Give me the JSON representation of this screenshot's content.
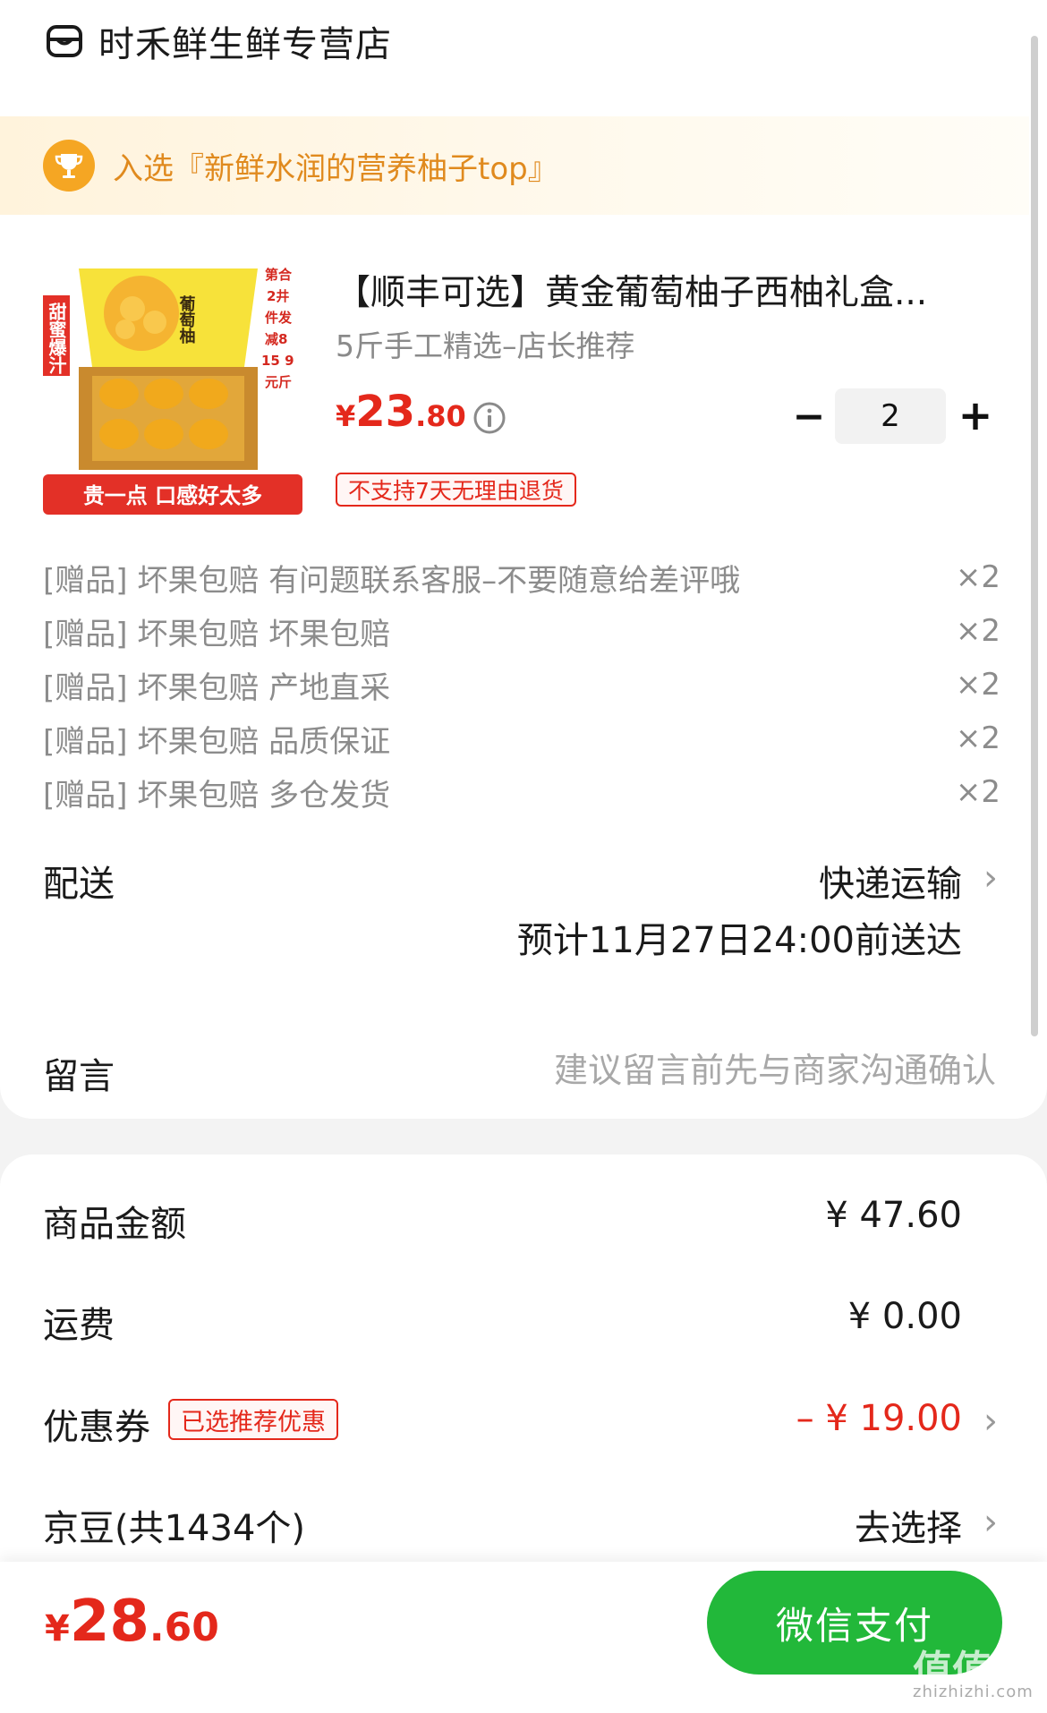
{
  "store": {
    "name": "时禾鲜生鲜专营店",
    "icon": "store-icon"
  },
  "award": {
    "text": "入选『新鲜水润的营养柚子top』",
    "icon": "trophy-icon",
    "color": "#e08a1e"
  },
  "product": {
    "title": "【顺丰可选】黄金葡萄柚子西柚礼盒...",
    "spec": "5斤手工精选–店长推荐",
    "price_symbol": "¥",
    "price_int": "23",
    "price_dec": ".80",
    "quantity": "2",
    "minus_label": "−",
    "plus_label": "+",
    "return_policy": "不支持7天无理由退货",
    "image_text": {
      "side_label": "甜蜜爆汁",
      "brand": "葡萄柚",
      "promo_line1": "第合",
      "promo_line2": "2井",
      "promo_line3": "件发",
      "promo_line4": "减8",
      "promo_line5": "15 9",
      "promo_line6": "元斤",
      "banner": "贵一点 口感好太多"
    }
  },
  "gifts": [
    {
      "label": "[赠品] 坏果包赔 有问题联系客服–不要随意给差评哦",
      "qty": "×2"
    },
    {
      "label": "[赠品] 坏果包赔 坏果包赔",
      "qty": "×2"
    },
    {
      "label": "[赠品] 坏果包赔 产地直采",
      "qty": "×2"
    },
    {
      "label": "[赠品] 坏果包赔 品质保证",
      "qty": "×2"
    },
    {
      "label": "[赠品] 坏果包赔 多仓发货",
      "qty": "×2"
    }
  ],
  "delivery": {
    "label": "配送",
    "method": "快递运输",
    "eta": "预计11月27日24:00前送达"
  },
  "note": {
    "label": "留言",
    "placeholder": "建议留言前先与商家沟通确认"
  },
  "summary": {
    "goods_label": "商品金额",
    "goods_value": "¥ 47.60",
    "shipping_label": "运费",
    "shipping_value": "¥ 0.00",
    "coupon_label": "优惠券",
    "coupon_tag": "已选推荐优惠",
    "coupon_value": "– ¥ 19.00",
    "beans_label": "京豆(共1434个)",
    "beans_action": "去选择"
  },
  "footer": {
    "total_symbol": "¥",
    "total_int": "28",
    "total_dec": ".60",
    "pay_label": "微信支付",
    "watermark": "值值值",
    "watermark_sub": "zhizhizhi.com"
  },
  "colors": {
    "accent_red": "#e4281b",
    "pay_green": "#22b83a",
    "award_orange": "#f5a623"
  }
}
